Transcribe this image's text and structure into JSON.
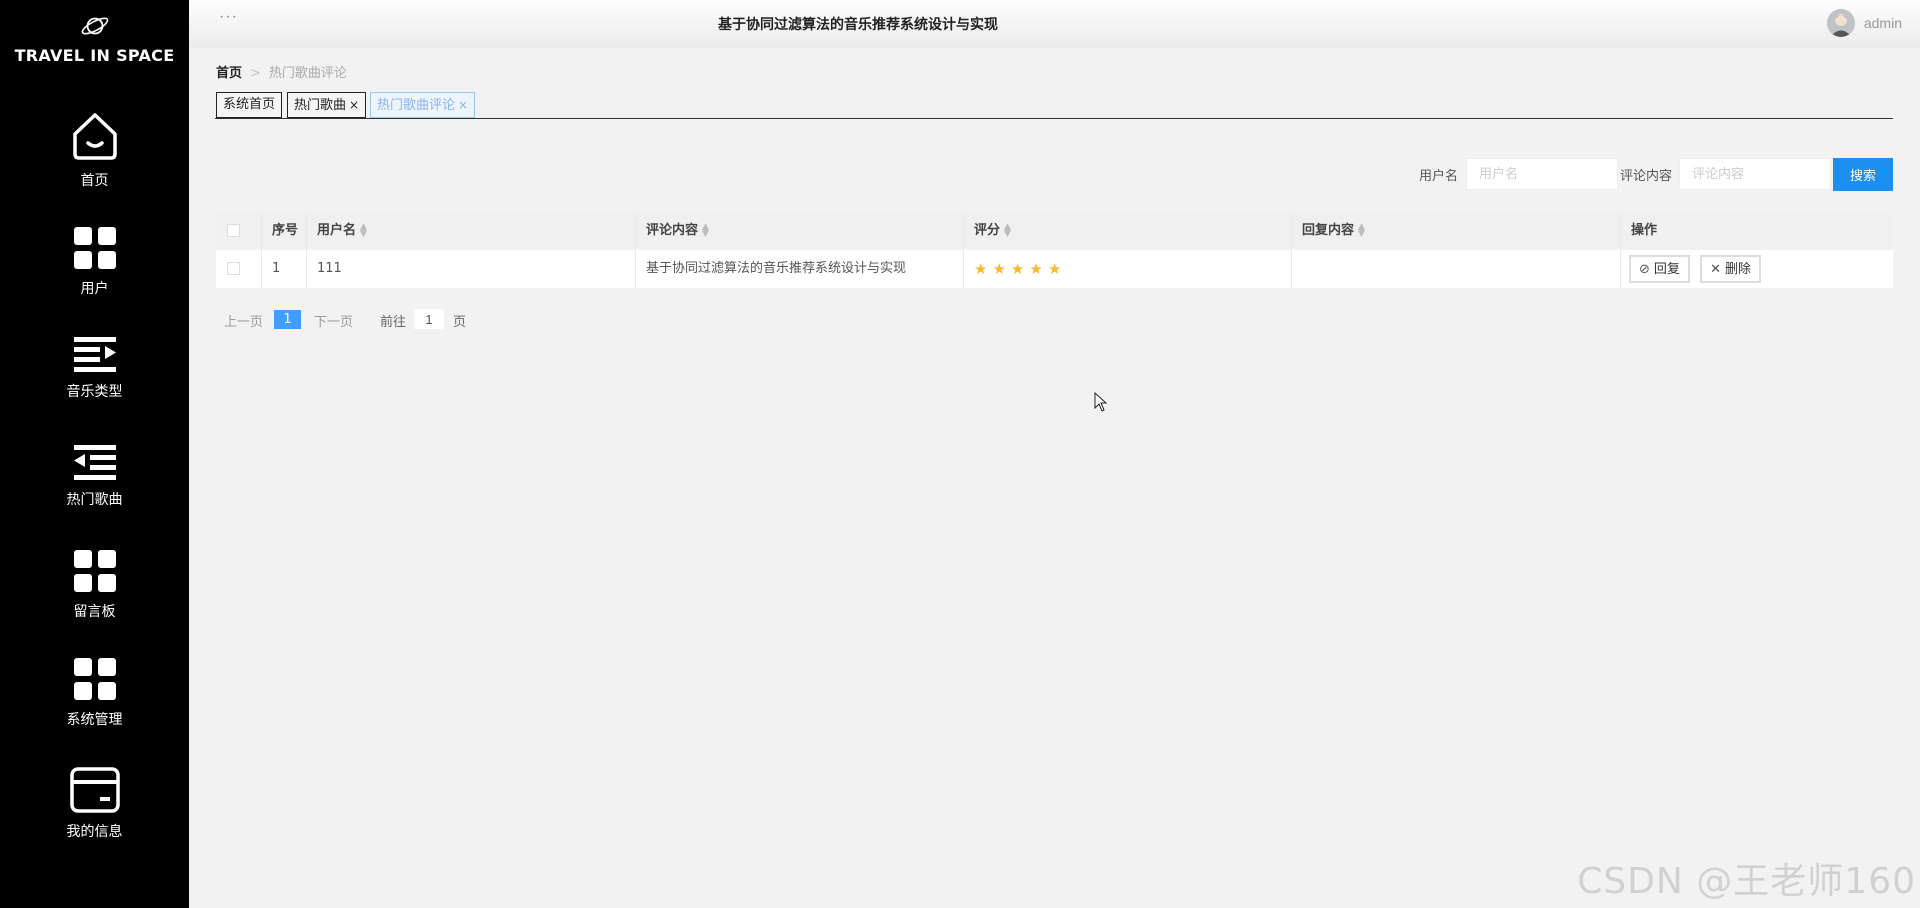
{
  "app": {
    "brand": "TRAVEL IN SPACE",
    "system_title": "基于协同过滤算法的音乐推荐系统设计与实现",
    "more_label": "···",
    "username": "admin"
  },
  "sidebar": {
    "items": [
      {
        "label": "首页",
        "icon": "home-icon"
      },
      {
        "label": "用户",
        "icon": "grid-icon"
      },
      {
        "label": "音乐类型",
        "icon": "list-indent-icon"
      },
      {
        "label": "热门歌曲",
        "icon": "list-outdent-icon"
      },
      {
        "label": "留言板",
        "icon": "grid-icon"
      },
      {
        "label": "系统管理",
        "icon": "grid-icon"
      },
      {
        "label": "我的信息",
        "icon": "card-icon"
      }
    ]
  },
  "breadcrumb": {
    "home": "首页",
    "separator": ">",
    "current": "热门歌曲评论"
  },
  "tabs": [
    {
      "label": "系统首页",
      "closable": false,
      "active": false
    },
    {
      "label": "热门歌曲",
      "closable": true,
      "active": false
    },
    {
      "label": "热门歌曲评论",
      "closable": true,
      "active": true
    }
  ],
  "tab_close_glyph": "×",
  "search": {
    "username_label": "用户名",
    "username_placeholder": "用户名",
    "username_value": "",
    "content_label": "评论内容",
    "content_placeholder": "评论内容",
    "content_value": "",
    "button_label": "搜索"
  },
  "table": {
    "columns": [
      "序号",
      "用户名",
      "评论内容",
      "评分",
      "回复内容",
      "操作"
    ],
    "rows": [
      {
        "index": "1",
        "username": "111",
        "content": "基于协同过滤算法的音乐推荐系统设计与实现",
        "rating": 5,
        "reply": ""
      }
    ],
    "reply_button": "回复",
    "delete_button": "删除"
  },
  "pagination": {
    "prev": "上一页",
    "current_page": "1",
    "next": "下一页",
    "goto_label": "前往",
    "goto_value": "1",
    "page_suffix": "页"
  },
  "watermark": "CSDN @王老师160",
  "colors": {
    "sidebar_bg": "#000000",
    "primary": "#1c8fef",
    "page_active": "#409eff",
    "star": "#f7ba2a"
  }
}
